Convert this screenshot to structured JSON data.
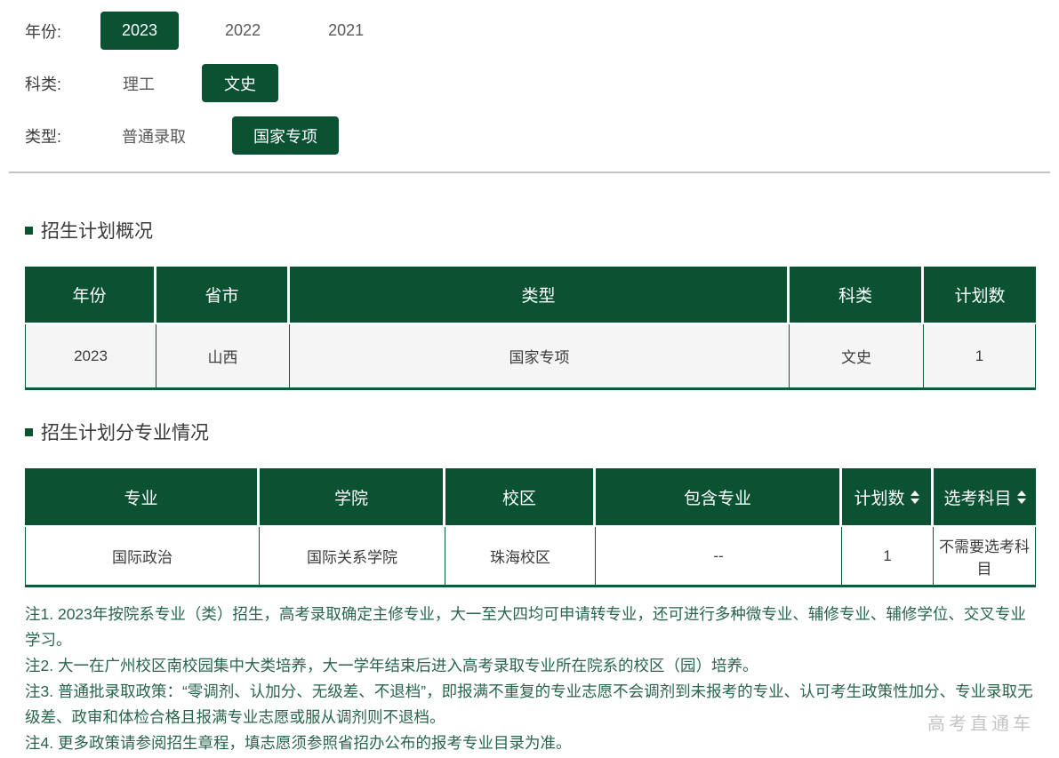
{
  "colors": {
    "primary_green": "#0b5233",
    "border_green": "#0e5a3a",
    "note_text_green": "#28654c",
    "row_gray": "#f5f5f5",
    "divider_gray": "#c3c3c3",
    "watermark_gray": "#c4c4c4"
  },
  "filters": [
    {
      "label": "年份:",
      "options": [
        {
          "label": "2023",
          "selected": true
        },
        {
          "label": "2022",
          "selected": false
        },
        {
          "label": "2021",
          "selected": false
        }
      ]
    },
    {
      "label": "科类:",
      "options": [
        {
          "label": "理工",
          "selected": false
        },
        {
          "label": "文史",
          "selected": true
        }
      ]
    },
    {
      "label": "类型:",
      "options": [
        {
          "label": "普通录取",
          "selected": false
        },
        {
          "label": "国家专项",
          "selected": true
        }
      ]
    }
  ],
  "sections": [
    {
      "title": "招生计划概况",
      "table": {
        "headers": [
          "年份",
          "省市",
          "类型",
          "科类",
          "计划数"
        ],
        "rows": [
          [
            "2023",
            "山西",
            "国家专项",
            "文史",
            "1"
          ]
        ]
      }
    },
    {
      "title": "招生计划分专业情况",
      "table": {
        "headers": [
          "专业",
          "学院",
          "校区",
          "包含专业",
          "计划数",
          "选考科目"
        ],
        "sortable_columns": [
          "计划数",
          "选考科目"
        ],
        "rows": [
          [
            "国际政治",
            "国际关系学院",
            "珠海校区",
            "--",
            "1",
            "不需要选考科目"
          ]
        ]
      }
    }
  ],
  "notes": [
    "注1. 2023年按院系专业（类）招生，高考录取确定主修专业，大一至大四均可申请转专业，还可进行多种微专业、辅修专业、辅修学位、交叉专业学习。",
    "注2. 大一在广州校区南校园集中大类培养，大一学年结束后进入高考录取专业所在院系的校区（园）培养。",
    "注3. 普通批录取政策：“零调剂、认加分、无级差、不退档”，即报满不重复的专业志愿不会调剂到未报考的专业、认可考生政策性加分、专业录取无级差、政审和体检合格且报满专业志愿或服从调剂则不退档。",
    "注4. 更多政策请参阅招生章程，填志愿须参照省招办公布的报考专业目录为准。"
  ],
  "watermark": "高考直通车"
}
